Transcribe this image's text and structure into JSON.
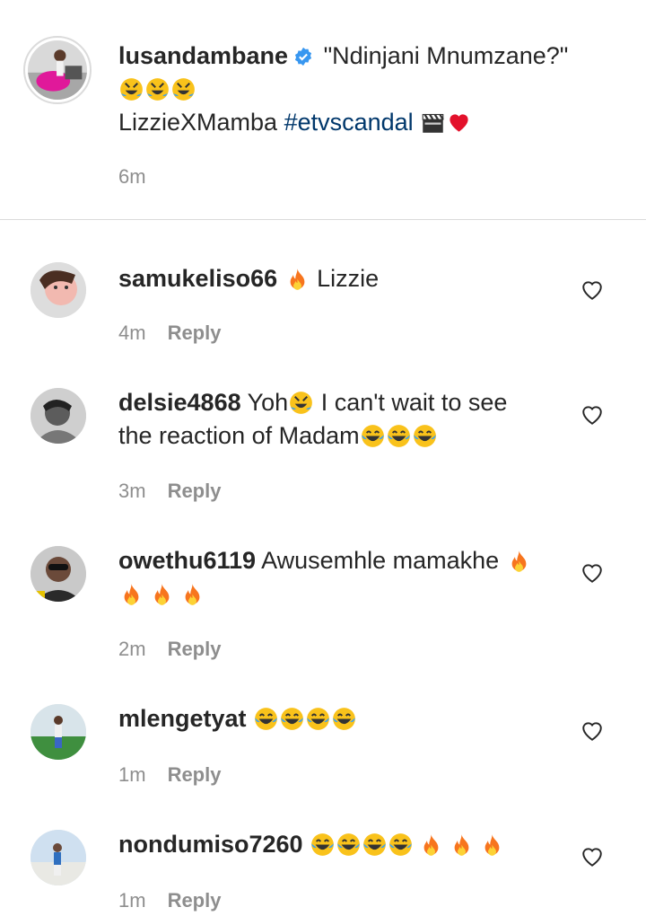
{
  "caption": {
    "username": "lusandambane",
    "text_part1": "\"Ndinjani Mnumzane?\"",
    "emojis_line2": [
      "rofl-emoji",
      "rofl-emoji",
      "rofl-emoji"
    ],
    "text_part2": "LizzieXMamba ",
    "hashtag": "#etvscandal",
    "time": "6m"
  },
  "comments": [
    {
      "username": "samukeliso66",
      "pre_emojis": [
        "fire-emoji"
      ],
      "text": "Lizzie",
      "time": "4m",
      "reply": "Reply"
    },
    {
      "username": "delsie4868",
      "text": "Yoh",
      "mid_emoji": "rofl-emoji",
      "text2": " I can't wait to see the reaction of Madam",
      "end_emojis": [
        "joy-emoji",
        "joy-emoji",
        "joy-emoji"
      ],
      "time": "3m",
      "reply": "Reply"
    },
    {
      "username": "owethu6119",
      "text": "Awusemhle mamakhe ",
      "end_emojis": [
        "fire-emoji",
        "fire-emoji",
        "fire-emoji",
        "fire-emoji"
      ],
      "time": "2m",
      "reply": "Reply"
    },
    {
      "username": "mlengetyat",
      "end_emojis": [
        "joy-emoji",
        "joy-emoji",
        "joy-emoji",
        "joy-emoji"
      ],
      "time": "1m",
      "reply": "Reply"
    },
    {
      "username": "nondumiso7260",
      "end_emojis": [
        "joy-emoji",
        "joy-emoji",
        "joy-emoji",
        "joy-emoji",
        "fire-emoji",
        "fire-emoji",
        "fire-emoji"
      ],
      "time": "1m",
      "reply": "Reply"
    }
  ]
}
